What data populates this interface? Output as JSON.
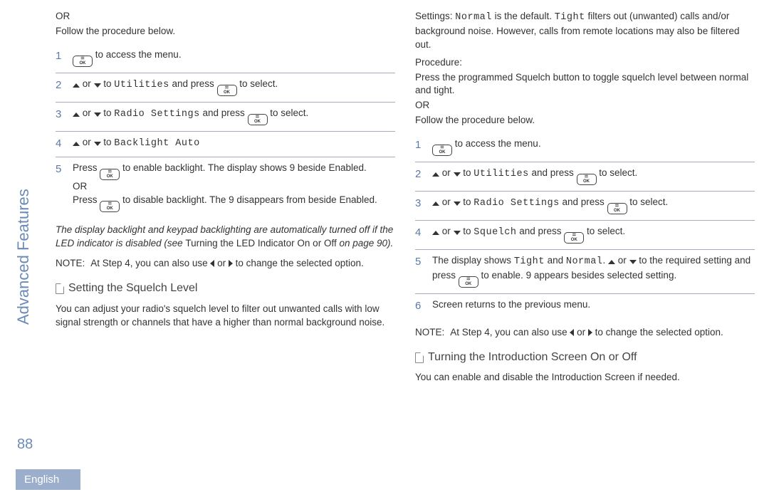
{
  "sidebar": {
    "label": "Advanced Features"
  },
  "page_number": "88",
  "language_tab": "English",
  "left": {
    "or": "OR",
    "follow": "Follow the procedure below.",
    "steps": [
      {
        "num": "1",
        "a": " to access the menu."
      },
      {
        "num": "2",
        "a": " or ",
        "b": " to ",
        "m": "Utilities",
        "c": " and press ",
        "d": " to select."
      },
      {
        "num": "3",
        "a": " or ",
        "b": " to ",
        "m": "Radio Settings",
        "c": " and press ",
        "d": " to select."
      },
      {
        "num": "4",
        "a": " or ",
        "b": " to ",
        "m": "Backlight Auto"
      },
      {
        "num": "5",
        "a": "Press ",
        "b": " to enable backlight. The display shows  9 beside Enabled.",
        "or": "OR",
        "c": "Press ",
        "d": " to disable backlight. The  9 disappears from beside Enabled."
      }
    ],
    "italic_note": "The display backlight and keypad backlighting are automatically turned off if the LED indicator is disabled (see ",
    "italic_link": "Turning the LED Indicator On or Off",
    "italic_suffix": "   on page 90).",
    "note_label": "NOTE:",
    "note_body_a": "At Step 4, you can also use ",
    "note_body_b": " or ",
    "note_body_c": " to change the selected option.",
    "section_title": "Setting the Squelch Level",
    "section_body": "You can adjust your radio's squelch level to filter out unwanted calls with low signal strength or channels that have a higher than normal background noise."
  },
  "right": {
    "settings_a": "Settings: ",
    "settings_m1": "Normal",
    "settings_b": " is the default. ",
    "settings_m2": "Tight",
    "settings_c": " filters out (unwanted) calls and/or background noise. However, calls from remote locations may also be filtered out.",
    "procedure": "Procedure:",
    "proc_body": "Press the programmed Squelch  button to toggle squelch level between normal and tight.",
    "or": "OR",
    "follow": "Follow the procedure below.",
    "steps": [
      {
        "num": "1",
        "a": " to access the menu."
      },
      {
        "num": "2",
        "a": " or ",
        "b": " to ",
        "m": "Utilities",
        "c": " and press ",
        "d": " to select."
      },
      {
        "num": "3",
        "a": " or ",
        "b": " to ",
        "m": "Radio Settings",
        "c": " and press ",
        "d": " to select."
      },
      {
        "num": "4",
        "a": " or ",
        "b": " to ",
        "m": "Squelch",
        "c": " and press ",
        "d": " to select."
      },
      {
        "num": "5",
        "a": "The display shows ",
        "m1": "Tight",
        "b": " and ",
        "m2": "Normal",
        "c": ". ",
        "d": " or ",
        "e": " to the required setting and press ",
        "f": " to enable.  9 appears besides selected setting."
      },
      {
        "num": "6",
        "a": "Screen returns to the previous menu."
      }
    ],
    "note_label": "NOTE:",
    "note_body_a": "At Step 4, you can also use ",
    "note_body_b": " or ",
    "note_body_c": " to change the selected option.",
    "section_title": "Turning the Introduction Screen On or Off",
    "section_body": "You can enable and disable the Introduction Screen if needed."
  }
}
